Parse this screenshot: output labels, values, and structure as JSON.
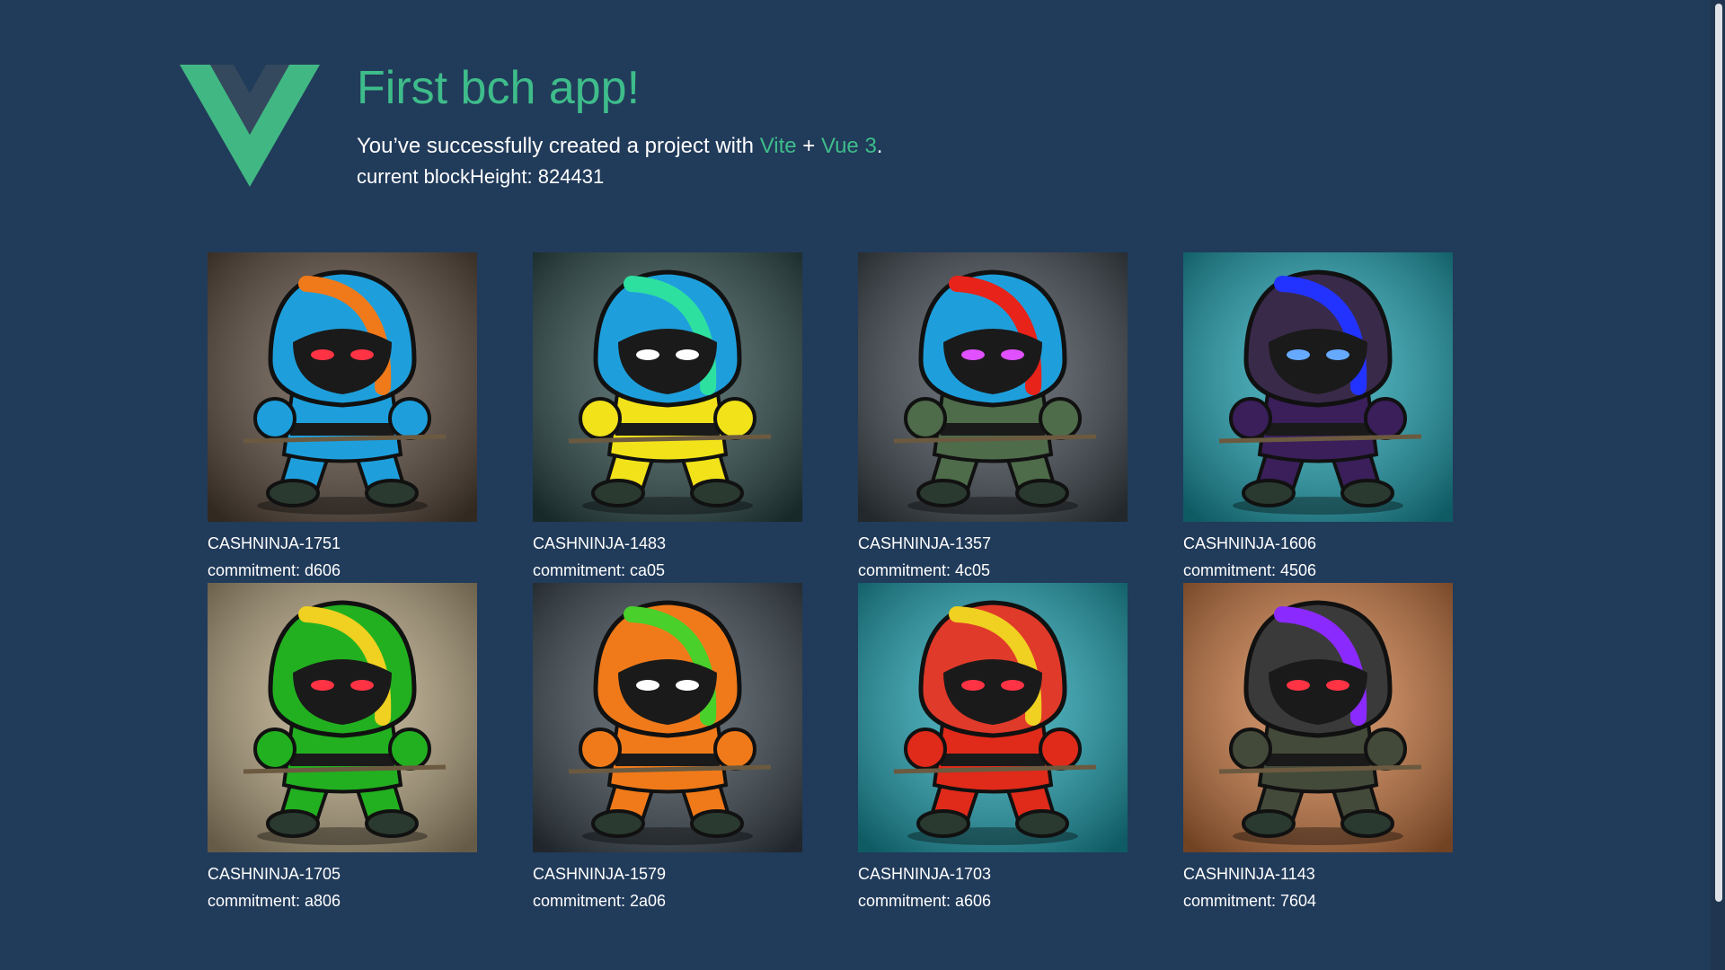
{
  "app": {
    "title": "First bch app!",
    "subtitle": {
      "prefix": "You’ve successfully created a project with ",
      "vite": "Vite",
      "plus": " + ",
      "vue": "Vue 3",
      "suffix": "."
    },
    "blockheight_label": "current blockHeight: ",
    "blockheight_value": "824431"
  },
  "colors": {
    "accent": "#3ebc8a",
    "background": "#213b5a"
  },
  "nfts": [
    {
      "name": "CASHNINJA-1751",
      "commitment": "commitment: d606",
      "hood": "#1e9fdc",
      "stripe": "#f07a1a",
      "body": "#1e9fdc",
      "eyes": "#ff3344",
      "bg": "#5b4a3c"
    },
    {
      "name": "CASHNINJA-1483",
      "commitment": "commitment: ca05",
      "hood": "#1e9fdc",
      "stripe": "#2ee0a0",
      "body": "#f2e21a",
      "eyes": "#ffffff",
      "bg": "#2c4a4a"
    },
    {
      "name": "CASHNINJA-1357",
      "commitment": "commitment: 4c05",
      "hood": "#1e9fdc",
      "stripe": "#e8231a",
      "body": "#4e6b4a",
      "eyes": "#e050ff",
      "bg": "#3f4850"
    },
    {
      "name": "CASHNINJA-1606",
      "commitment": "commitment: 4506",
      "hood": "#3a2a4a",
      "stripe": "#2233ff",
      "body": "#3a1f5a",
      "eyes": "#66aaff",
      "bg": "#1aa5b5"
    },
    {
      "name": "CASHNINJA-1705",
      "commitment": "commitment: a806",
      "hood": "#22b020",
      "stripe": "#f0d020",
      "body": "#22b020",
      "eyes": "#ff3344",
      "bg": "#b8a680"
    },
    {
      "name": "CASHNINJA-1579",
      "commitment": "commitment: 2a06",
      "hood": "#f07a1a",
      "stripe": "#4ad02a",
      "body": "#f07a1a",
      "eyes": "#ffffff",
      "bg": "#3a4650"
    },
    {
      "name": "CASHNINJA-1703",
      "commitment": "commitment: a606",
      "hood": "#e03a2a",
      "stripe": "#f0d020",
      "body": "#e02a1a",
      "eyes": "#ff3344",
      "bg": "#1aa5b5"
    },
    {
      "name": "CASHNINJA-1143",
      "commitment": "commitment: 7604",
      "hood": "#3a3a3a",
      "stripe": "#8a2aff",
      "body": "#444a3a",
      "eyes": "#ff3344",
      "bg": "#d07a40"
    }
  ]
}
